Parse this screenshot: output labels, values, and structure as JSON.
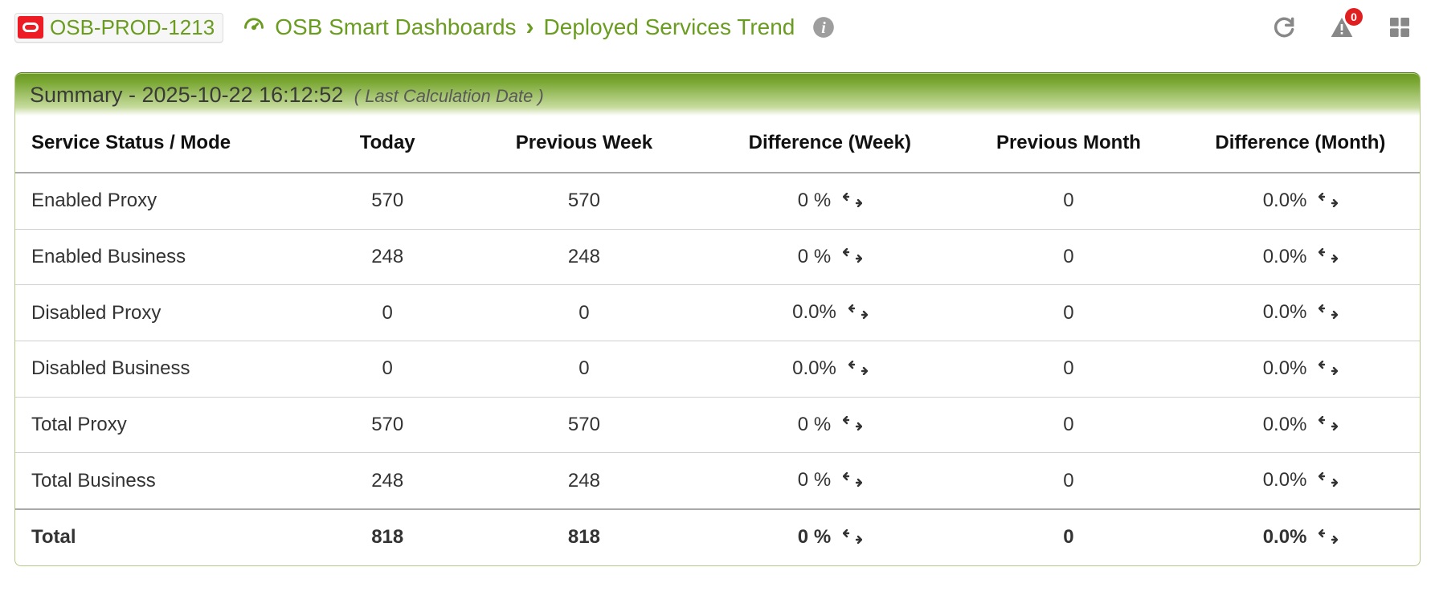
{
  "header": {
    "env_name": "OSB-PROD-1213",
    "crumb1": "OSB Smart Dashboards",
    "crumb2": "Deployed Services Trend",
    "alert_count": "0"
  },
  "panel": {
    "title_prefix": "Summary - ",
    "timestamp": "2025-10-22 16:12:52",
    "subtitle": "( Last Calculation Date )"
  },
  "table": {
    "columns": {
      "c1": "Service Status / Mode",
      "c2": "Today",
      "c3": "Previous Week",
      "c4": "Difference (Week)",
      "c5": "Previous Month",
      "c6": "Difference (Month)"
    },
    "rows": [
      {
        "label": "Enabled Proxy",
        "today": "570",
        "prev_week": "570",
        "diff_week": "0 %",
        "prev_month": "0",
        "diff_month": "0.0%"
      },
      {
        "label": "Enabled Business",
        "today": "248",
        "prev_week": "248",
        "diff_week": "0 %",
        "prev_month": "0",
        "diff_month": "0.0%"
      },
      {
        "label": "Disabled Proxy",
        "today": "0",
        "prev_week": "0",
        "diff_week": "0.0%",
        "prev_month": "0",
        "diff_month": "0.0%"
      },
      {
        "label": "Disabled Business",
        "today": "0",
        "prev_week": "0",
        "diff_week": "0.0%",
        "prev_month": "0",
        "diff_month": "0.0%"
      },
      {
        "label": "Total Proxy",
        "today": "570",
        "prev_week": "570",
        "diff_week": "0 %",
        "prev_month": "0",
        "diff_month": "0.0%"
      },
      {
        "label": "Total Business",
        "today": "248",
        "prev_week": "248",
        "diff_week": "0 %",
        "prev_month": "0",
        "diff_month": "0.0%"
      }
    ],
    "total": {
      "label": "Total",
      "today": "818",
      "prev_week": "818",
      "diff_week": "0 %",
      "prev_month": "0",
      "diff_month": "0.0%"
    }
  }
}
